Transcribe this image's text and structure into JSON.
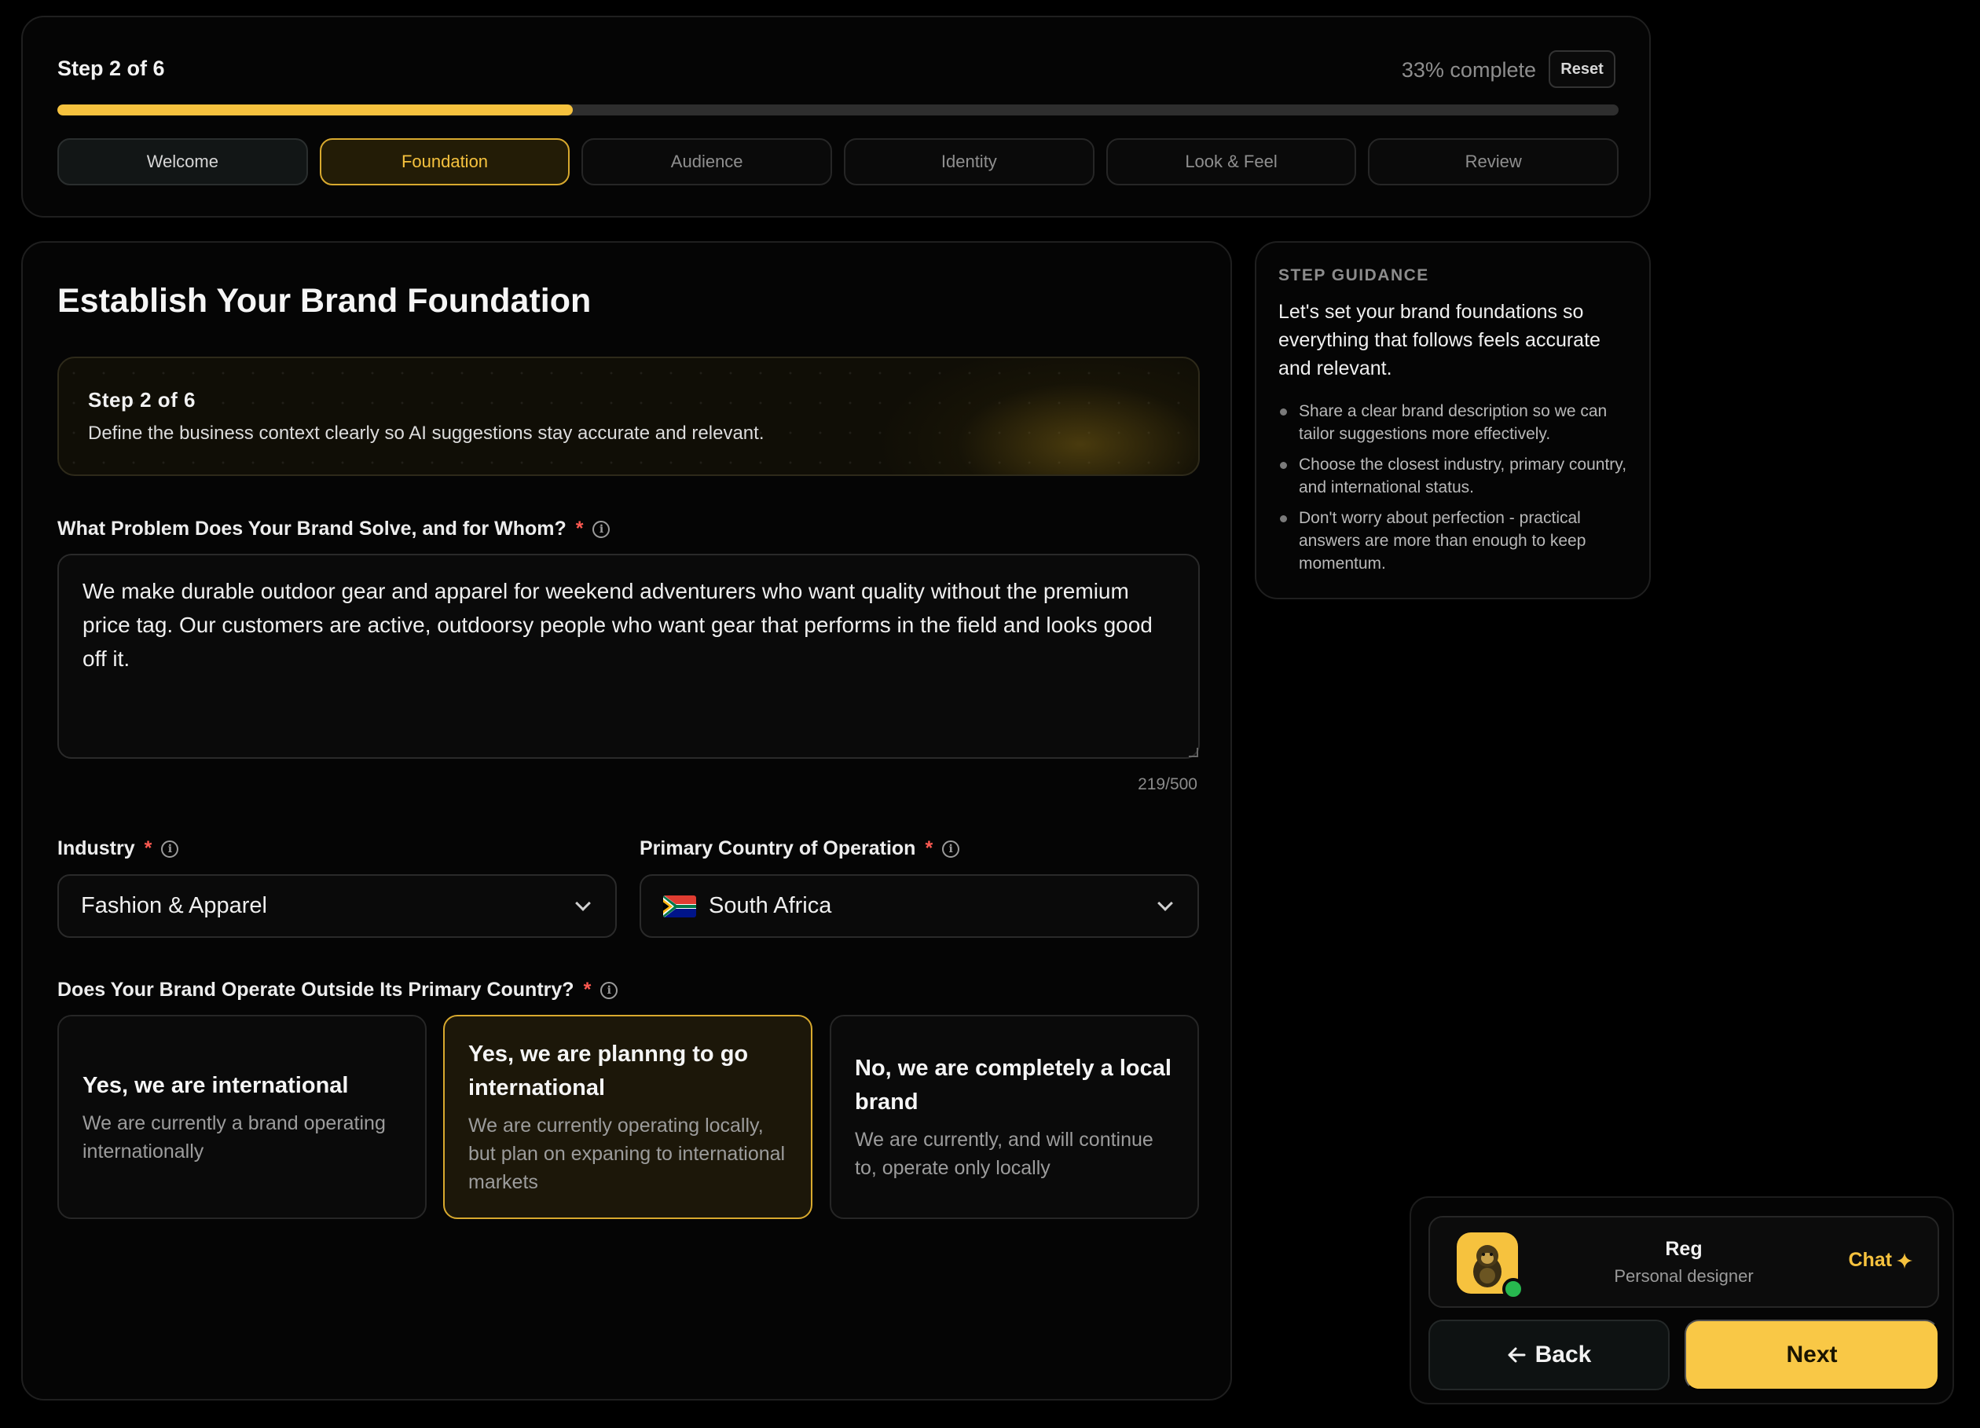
{
  "progress": {
    "step_label": "Step 2 of 6",
    "percent_label": "33% complete",
    "percent_value": 33,
    "reset_label": "Reset",
    "tabs": [
      {
        "label": "Welcome",
        "state": "done"
      },
      {
        "label": "Foundation",
        "state": "active"
      },
      {
        "label": "Audience",
        "state": "upcoming"
      },
      {
        "label": "Identity",
        "state": "upcoming"
      },
      {
        "label": "Look & Feel",
        "state": "upcoming"
      },
      {
        "label": "Review",
        "state": "upcoming"
      }
    ]
  },
  "main": {
    "title": "Establish Your Brand Foundation",
    "banner": {
      "title": "Step 2 of 6",
      "text": "Define the business context clearly so AI suggestions stay accurate and relevant."
    },
    "problem": {
      "label": "What Problem Does Your Brand Solve, and for Whom?",
      "required_mark": "*",
      "value": "We make durable outdoor gear and apparel for weekend adventurers who want quality without the premium price tag. Our customers are active, outdoorsy people who want gear that performs in the field and looks good off it.",
      "counter": "219/500"
    },
    "industry": {
      "label": "Industry",
      "required_mark": "*",
      "value": "Fashion & Apparel"
    },
    "country": {
      "label": "Primary Country of Operation",
      "required_mark": "*",
      "value": "South Africa"
    },
    "international": {
      "label": "Does Your Brand Operate Outside Its Primary Country?",
      "required_mark": "*",
      "options": [
        {
          "title": "Yes, we are international",
          "desc": "We are currently a brand operating internationally",
          "selected": false
        },
        {
          "title": "Yes, we are plannng to go international",
          "desc": "We are currently operating locally, but plan on expaning to international markets",
          "selected": true
        },
        {
          "title": "No, we are completely a local brand",
          "desc": "We are currently, and will continue to, operate only locally",
          "selected": false
        }
      ]
    }
  },
  "guidance": {
    "heading": "STEP GUIDANCE",
    "lead": "Let's set your brand foundations so everything that follows feels accurate and relevant.",
    "items": [
      "Share a clear brand description so we can tailor suggestions more effectively.",
      "Choose the closest industry, primary country, and international status.",
      "Don't worry about perfection - practical answers are more than enough to keep momentum."
    ]
  },
  "assistant": {
    "name": "Reg",
    "role": "Personal designer",
    "chat_label": "Chat",
    "chat_icon": "sparkle-icon"
  },
  "nav": {
    "back_label": "Back",
    "next_label": "Next"
  },
  "colors": {
    "accent": "#f6c23e",
    "required": "#ff5a52",
    "online": "#27b84f"
  }
}
